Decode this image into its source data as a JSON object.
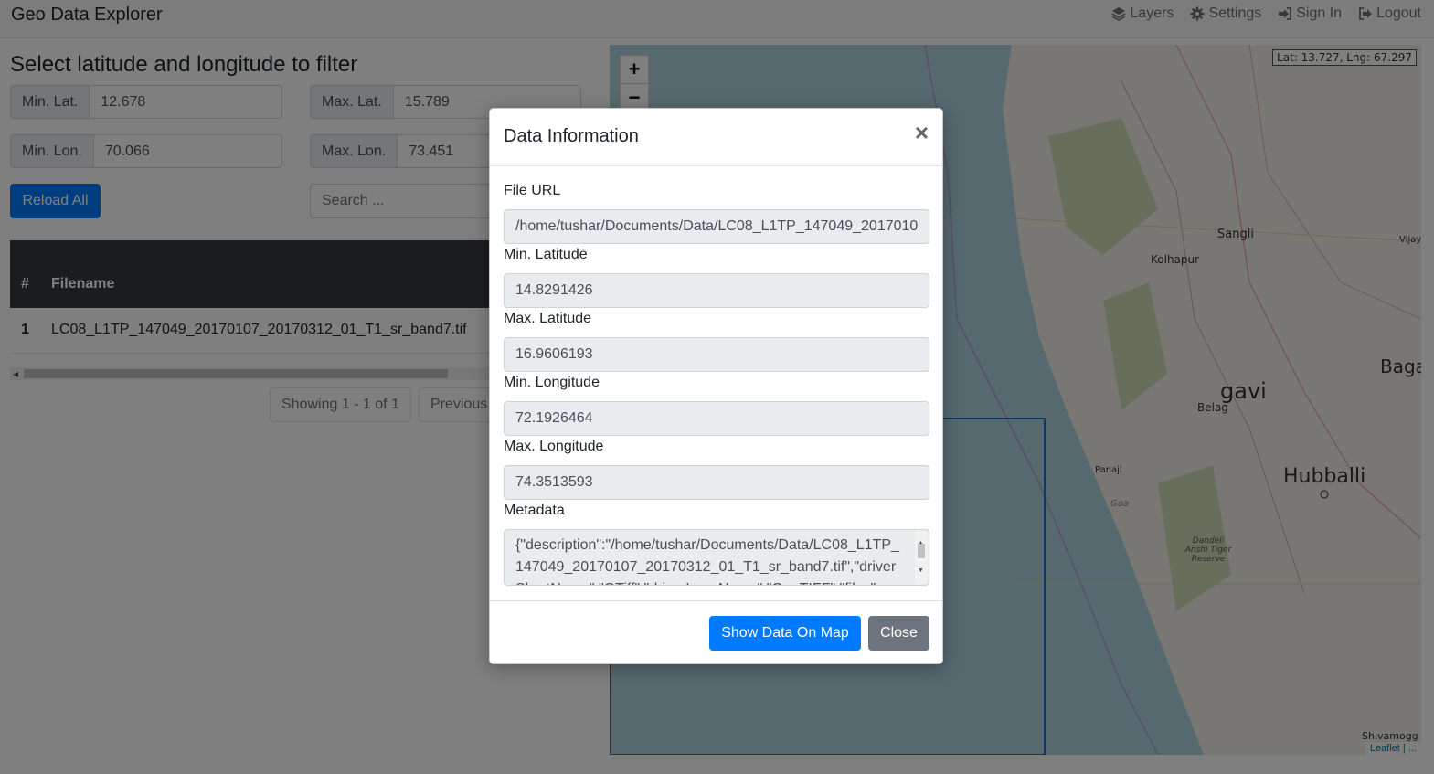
{
  "navbar": {
    "brand": "Geo Data Explorer",
    "links": [
      {
        "icon": "layers-icon",
        "label": "Layers"
      },
      {
        "icon": "gear-icon",
        "label": "Settings"
      },
      {
        "icon": "sign-in-icon",
        "label": "Sign In"
      },
      {
        "icon": "sign-out-icon",
        "label": "Logout"
      }
    ]
  },
  "filter": {
    "title": "Select latitude and longitude to filter",
    "min_lat": {
      "label": "Min. Lat.",
      "value": "12.678"
    },
    "max_lat": {
      "label": "Max. Lat.",
      "value": "15.789"
    },
    "min_lon": {
      "label": "Min. Lon.",
      "value": "70.066"
    },
    "max_lon": {
      "label": "Max. Lon.",
      "value": "73.451"
    },
    "reload_label": "Reload All",
    "search_placeholder": "Search ..."
  },
  "table": {
    "headers": [
      "#",
      "Filename"
    ],
    "rows": [
      {
        "num": "1",
        "filename": "LC08_L1TP_147049_20170107_20170312_01_T1_sr_band7.tif"
      }
    ]
  },
  "pagination": {
    "info": "Showing 1 - 1 of 1",
    "previous": "Previous"
  },
  "map": {
    "coords": "Lat: 13.727, Lng: 67.297",
    "zoom_in": "+",
    "zoom_out": "−",
    "attribution": "Leaflet | ...",
    "place_labels": [
      "Sangli",
      "Kolhapur",
      "Vijaya",
      "Baga",
      "gavi",
      "Belag",
      "Panaji",
      "Goa",
      "Hubballi",
      "Dandeli Anshi Tiger Reserve",
      "Shivamogg"
    ],
    "colors": {
      "sea": "#aad3df",
      "land": "#f2efe9",
      "forest": "#c8d7ab",
      "boundary": "#b0b0d0",
      "footprint": "#1f6fd1"
    }
  },
  "modal": {
    "title": "Data Information",
    "close_glyph": "×",
    "file_url": {
      "label": "File URL",
      "value": "/home/tushar/Documents/Data/LC08_L1TP_147049_2017010"
    },
    "min_latitude": {
      "label": "Min. Latitude",
      "value": "14.8291426"
    },
    "max_latitude": {
      "label": "Max. Latitude",
      "value": "16.9606193"
    },
    "min_longitude": {
      "label": "Min. Longitude",
      "value": "72.1926464"
    },
    "max_longitude": {
      "label": "Max. Longitude",
      "value": "74.3513593"
    },
    "metadata": {
      "label": "Metadata",
      "value": "{\"description\":\"/home/tushar/Documents/Data/LC08_L1TP_147049_20170107_20170312_01_T1_sr_band7.tif\",\"driverShortName\":\"GTiff\",\"driverLongName\":\"GeoTIFF\",\"files\":"
    },
    "show_on_map": "Show Data On Map",
    "close": "Close"
  }
}
